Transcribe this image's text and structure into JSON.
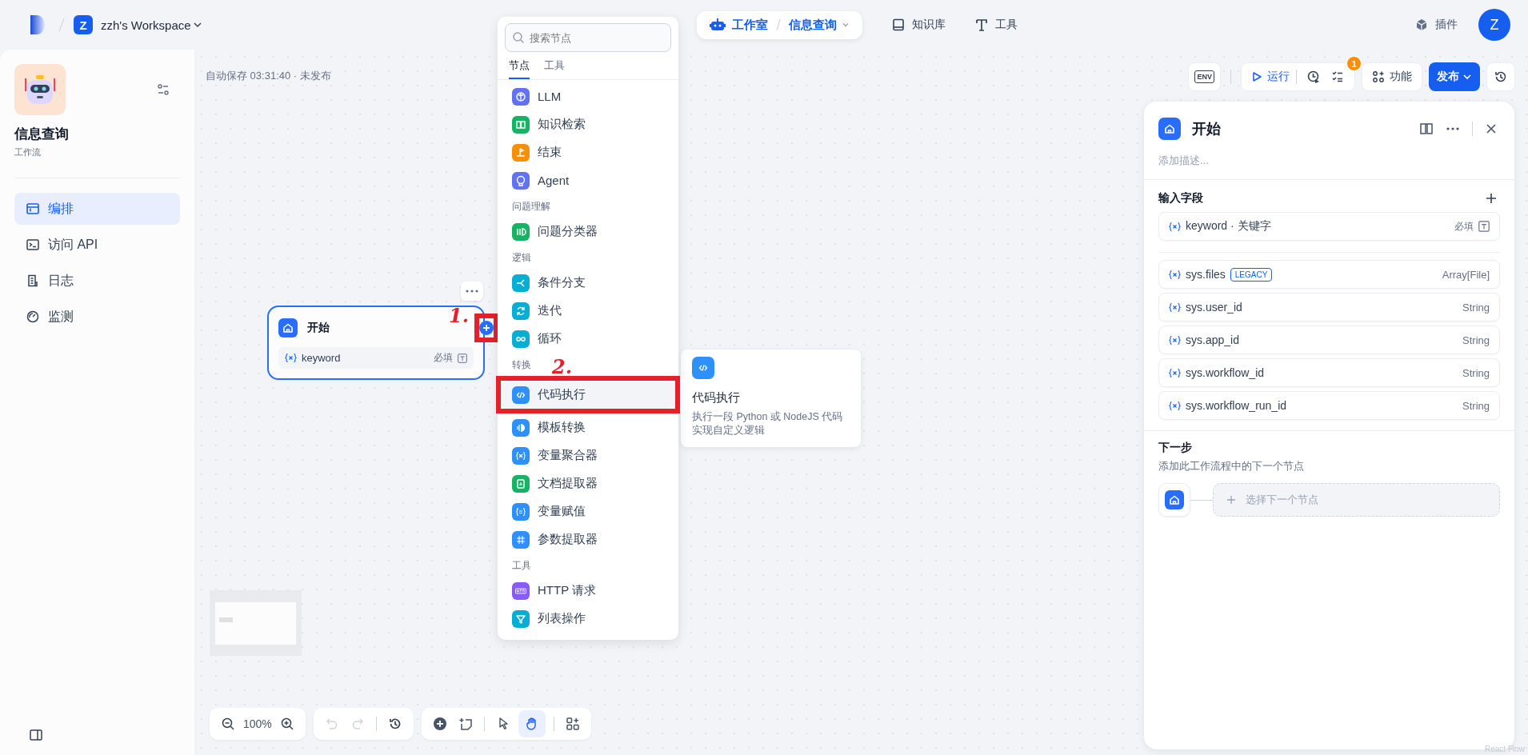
{
  "header": {
    "workspace_initial": "Z",
    "workspace_name": "zzh's Workspace",
    "nav": [
      {
        "label": "工作室",
        "page": "信息查询",
        "selected": true
      },
      {
        "label": "知识库",
        "selected": false
      },
      {
        "label": "工具",
        "selected": false
      }
    ],
    "plugins": "插件",
    "avatar": "Z"
  },
  "sidebar": {
    "app_name": "信息查询",
    "app_type": "工作流",
    "items": [
      {
        "label": "编排",
        "selected": true
      },
      {
        "label": "访问 API",
        "selected": false
      },
      {
        "label": "日志",
        "selected": false
      },
      {
        "label": "监测",
        "selected": false
      }
    ]
  },
  "canvas": {
    "autosave": "自动保存 03:31:40 · 未发布",
    "zoom": "100%"
  },
  "toolbar": {
    "env": "ENV",
    "run": "运行",
    "badge": "1",
    "features": "功能",
    "publish": "发布"
  },
  "start_node": {
    "title": "开始",
    "field": "keyword",
    "required": "必填"
  },
  "node_menu": {
    "placeholder": "搜索节点",
    "tabs": [
      {
        "label": "节点",
        "selected": true
      },
      {
        "label": "工具",
        "selected": false
      }
    ],
    "sections": [
      {
        "items": [
          {
            "label": "LLM",
            "color": "#6172f3",
            "selected": false
          },
          {
            "label": "知识检索",
            "color": "#16b364",
            "selected": false
          },
          {
            "label": "结束",
            "color": "#f79009",
            "selected": false
          },
          {
            "label": "Agent",
            "color": "#6172f3",
            "selected": false
          }
        ]
      },
      {
        "title": "问题理解",
        "items": [
          {
            "label": "问题分类器",
            "color": "#16b364",
            "selected": false
          }
        ]
      },
      {
        "title": "逻辑",
        "items": [
          {
            "label": "条件分支",
            "color": "#06aed4",
            "selected": false
          },
          {
            "label": "迭代",
            "color": "#06aed4",
            "selected": false
          },
          {
            "label": "循环",
            "color": "#06aed4",
            "selected": false
          }
        ]
      },
      {
        "title": "转换",
        "items": [
          {
            "label": "代码执行",
            "color": "#2e90fa",
            "selected": true
          },
          {
            "label": "模板转换",
            "color": "#2e90fa",
            "selected": false
          },
          {
            "label": "变量聚合器",
            "color": "#2e90fa",
            "selected": false
          },
          {
            "label": "文档提取器",
            "color": "#16b364",
            "selected": false
          },
          {
            "label": "变量赋值",
            "color": "#2e90fa",
            "selected": false
          },
          {
            "label": "参数提取器",
            "color": "#2e90fa",
            "selected": false
          }
        ]
      },
      {
        "title": "工具",
        "items": [
          {
            "label": "HTTP 请求",
            "color": "#875bf7",
            "selected": false
          },
          {
            "label": "列表操作",
            "color": "#06aed4",
            "selected": false
          }
        ]
      }
    ]
  },
  "tooltip": {
    "title": "代码执行",
    "description": "执行一段 Python 或 NodeJS 代码实现自定义逻辑"
  },
  "annotations": [
    {
      "label": "1."
    },
    {
      "label": "2."
    }
  ],
  "panel": {
    "title": "开始",
    "description_placeholder": "添加描述...",
    "inputs_title": "输入字段",
    "inputs": [
      {
        "name": "keyword · 关键字",
        "required": "必填"
      }
    ],
    "system": [
      {
        "name": "sys.files",
        "badge": "LEGACY",
        "type": "Array[File]"
      },
      {
        "name": "sys.user_id",
        "type": "String"
      },
      {
        "name": "sys.app_id",
        "type": "String"
      },
      {
        "name": "sys.workflow_id",
        "type": "String"
      },
      {
        "name": "sys.workflow_run_id",
        "type": "String"
      }
    ],
    "next_title": "下一步",
    "next_description": "添加此工作流程中的下一个节点",
    "next_placeholder": "选择下一个节点"
  },
  "attribution": "React Flow"
}
